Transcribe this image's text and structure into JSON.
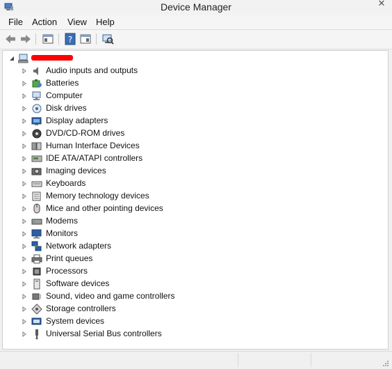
{
  "window": {
    "title": "Device Manager",
    "close_glyph": "✕"
  },
  "menu": [
    {
      "label": "File"
    },
    {
      "label": "Action"
    },
    {
      "label": "View"
    },
    {
      "label": "Help"
    }
  ],
  "toolbar": {
    "buttons": [
      {
        "icon": "back-arrow-icon"
      },
      {
        "icon": "forward-arrow-icon"
      },
      {
        "icon": "show-hide-console-tree-icon"
      },
      {
        "icon": "help-icon"
      },
      {
        "icon": "properties-pane-icon"
      },
      {
        "icon": "scan-hardware-changes-icon"
      }
    ]
  },
  "tree": {
    "root": {
      "icon": "computer-icon",
      "label_redacted": true
    },
    "categories": [
      {
        "label": "Audio inputs and outputs",
        "icon": "speaker-icon"
      },
      {
        "label": "Batteries",
        "icon": "battery-icon"
      },
      {
        "label": "Computer",
        "icon": "computer-icon"
      },
      {
        "label": "Disk drives",
        "icon": "disk-drive-icon"
      },
      {
        "label": "Display adapters",
        "icon": "display-adapter-icon"
      },
      {
        "label": "DVD/CD-ROM drives",
        "icon": "dvd-icon"
      },
      {
        "label": "Human Interface Devices",
        "icon": "hid-icon"
      },
      {
        "label": "IDE ATA/ATAPI controllers",
        "icon": "ide-controller-icon"
      },
      {
        "label": "Imaging devices",
        "icon": "camera-icon"
      },
      {
        "label": "Keyboards",
        "icon": "keyboard-icon"
      },
      {
        "label": "Memory technology devices",
        "icon": "memory-icon"
      },
      {
        "label": "Mice and other pointing devices",
        "icon": "mouse-icon"
      },
      {
        "label": "Modems",
        "icon": "modem-icon"
      },
      {
        "label": "Monitors",
        "icon": "monitor-icon"
      },
      {
        "label": "Network adapters",
        "icon": "network-adapter-icon"
      },
      {
        "label": "Print queues",
        "icon": "printer-icon"
      },
      {
        "label": "Processors",
        "icon": "processor-icon"
      },
      {
        "label": "Software devices",
        "icon": "software-device-icon"
      },
      {
        "label": "Sound, video and game controllers",
        "icon": "sound-icon"
      },
      {
        "label": "Storage controllers",
        "icon": "storage-controller-icon"
      },
      {
        "label": "System devices",
        "icon": "system-devices-icon"
      },
      {
        "label": "Universal Serial Bus controllers",
        "icon": "usb-icon"
      }
    ]
  },
  "colors": {
    "redaction": "#ff0000",
    "accent": "#1a5fb4"
  }
}
